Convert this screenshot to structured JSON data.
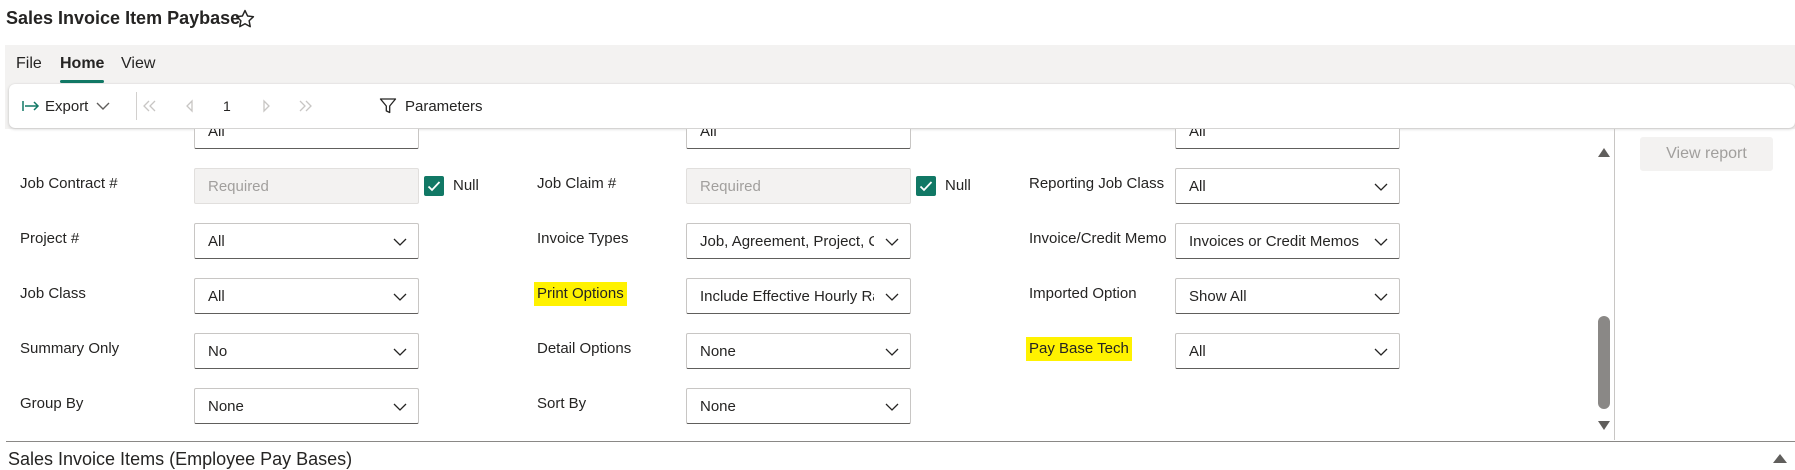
{
  "title": "Sales Invoice Item Paybase",
  "menu": {
    "tabs": [
      {
        "label": "File",
        "active": false
      },
      {
        "label": "Home",
        "active": true
      },
      {
        "label": "View",
        "active": false
      }
    ]
  },
  "toolbar": {
    "export_label": "Export",
    "page_number": "1",
    "parameters_label": "Parameters"
  },
  "params": {
    "partial_top_values": [
      "All",
      "All",
      "All"
    ],
    "job_contract": {
      "label": "Job Contract #",
      "placeholder": "Required",
      "null_label": "Null",
      "null_checked": true
    },
    "job_claim": {
      "label": "Job Claim #",
      "placeholder": "Required",
      "null_label": "Null",
      "null_checked": true
    },
    "reporting_job_class": {
      "label": "Reporting Job Class",
      "value": "All"
    },
    "project": {
      "label": "Project #",
      "value": "All"
    },
    "invoice_types": {
      "label": "Invoice Types",
      "value": "Job, Agreement, Project, C"
    },
    "invoice_credit_memo": {
      "label": "Invoice/Credit Memo",
      "value": "Invoices or Credit Memos"
    },
    "job_class": {
      "label": "Job Class",
      "value": "All"
    },
    "print_options": {
      "label": "Print Options",
      "value": "Include Effective Hourly Ra"
    },
    "imported_option": {
      "label": "Imported Option",
      "value": "Show All"
    },
    "summary_only": {
      "label": "Summary Only",
      "value": "No"
    },
    "detail_options": {
      "label": "Detail Options",
      "value": "None"
    },
    "pay_base_tech": {
      "label": "Pay Base Tech",
      "value": "All"
    },
    "group_by": {
      "label": "Group By",
      "value": "None"
    },
    "sort_by": {
      "label": "Sort By",
      "value": "None"
    }
  },
  "view_report_label": "View report",
  "section_title": "Sales Invoice Items (Employee Pay Bases)",
  "colors": {
    "accent": "#117865",
    "highlight": "#fff200"
  }
}
